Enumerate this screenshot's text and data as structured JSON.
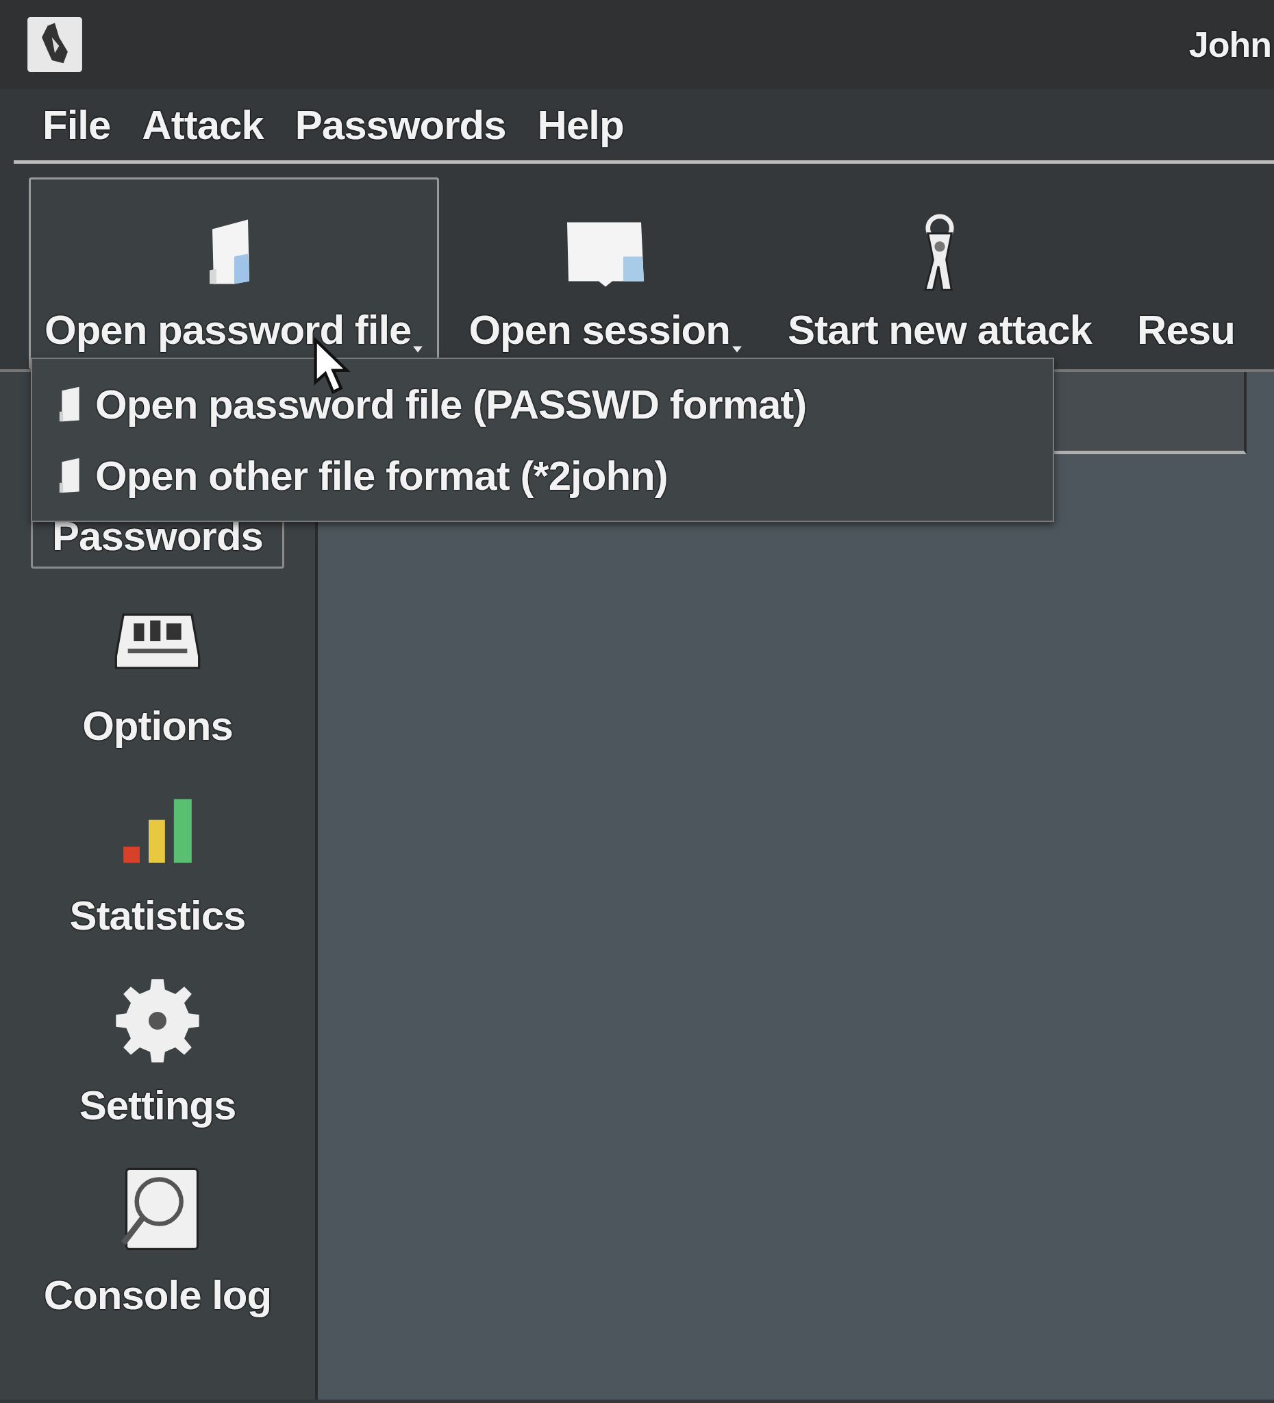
{
  "window": {
    "title": "John"
  },
  "menu_bar": [
    {
      "label": "File"
    },
    {
      "label": "Attack"
    },
    {
      "label": "Passwords"
    },
    {
      "label": "Help"
    }
  ],
  "toolbar": [
    {
      "label": "Open password file",
      "dropdown": true,
      "selected": true
    },
    {
      "label": "Open session",
      "dropdown": true,
      "selected": false
    },
    {
      "label": "Start new attack",
      "dropdown": false,
      "selected": false
    },
    {
      "label": "Resu",
      "dropdown": false,
      "selected": false
    }
  ],
  "dropdown_menu": {
    "items": [
      {
        "label": "Open password file (PASSWD format)"
      },
      {
        "label": "Open other file format (*2john)"
      }
    ]
  },
  "sidebar": {
    "items": [
      {
        "label": "Passwords",
        "selected": true
      },
      {
        "label": "Options",
        "selected": false
      },
      {
        "label": "Statistics",
        "selected": false
      },
      {
        "label": "Settings",
        "selected": false
      },
      {
        "label": "Console log",
        "selected": false
      }
    ]
  }
}
